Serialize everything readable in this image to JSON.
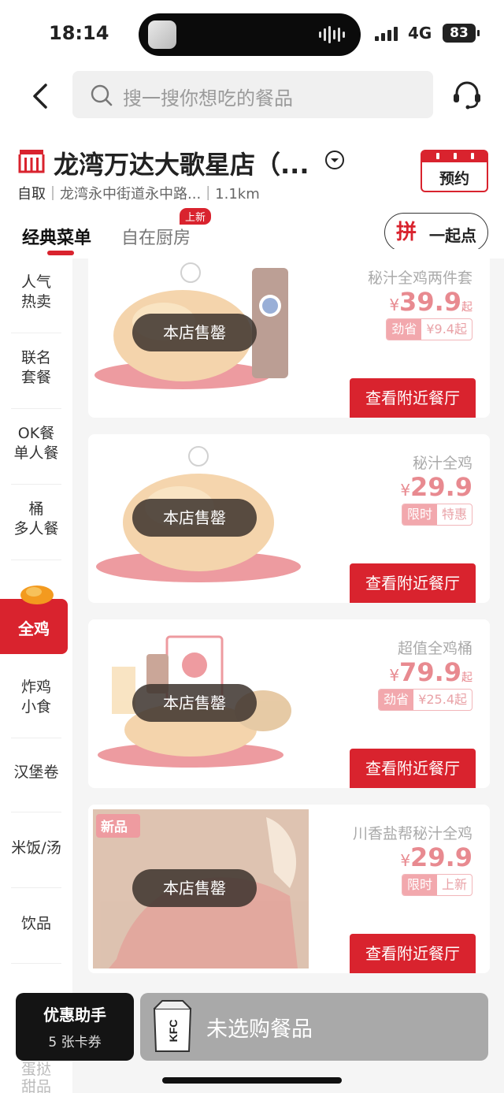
{
  "status_bar": {
    "time": "18:14",
    "network": "4G",
    "battery": "83"
  },
  "search": {
    "placeholder": "搜一搜你想吃的餐品"
  },
  "store": {
    "name": "龙湾万达大歌星店（...",
    "pickup": "自取",
    "address": "｜龙湾永中街道永中路...｜1.1km",
    "reserve_label": "预约"
  },
  "tabs": {
    "classic": "经典菜单",
    "kitchen": "自在厨房",
    "new_badge": "上新"
  },
  "group_order": {
    "icon": "拼",
    "label": "一起点"
  },
  "sidebar": {
    "categories": [
      {
        "line1": "人气",
        "line2": "热卖"
      },
      {
        "line1": "联名",
        "line2": "套餐"
      },
      {
        "line1": "OK餐",
        "line2": "单人餐"
      },
      {
        "line1": "桶",
        "line2": "多人餐"
      },
      {
        "line1": "全鸡",
        "line2": ""
      },
      {
        "line1": "炸鸡",
        "line2": "小食"
      },
      {
        "line1": "汉堡卷",
        "line2": ""
      },
      {
        "line1": "米饭/汤",
        "line2": ""
      },
      {
        "line1": "饮品",
        "line2": ""
      }
    ],
    "peek": [
      "蛋挞",
      "甜品"
    ]
  },
  "products": [
    {
      "name": "秘汁全鸡两件套",
      "currency": "¥",
      "price": "39.9",
      "suffix": "起",
      "tag_a": "劲省",
      "tag_b": "¥9.4起",
      "soldout": "本店售罄",
      "cta": "查看附近餐厅",
      "image_badge": ""
    },
    {
      "name": "秘汁全鸡",
      "currency": "¥",
      "price": "29.9",
      "suffix": "",
      "tag_a": "限时",
      "tag_b": "特惠",
      "soldout": "本店售罄",
      "cta": "查看附近餐厅",
      "image_badge": ""
    },
    {
      "name": "超值全鸡桶",
      "currency": "¥",
      "price": "79.9",
      "suffix": "起",
      "tag_a": "劲省",
      "tag_b": "¥25.4起",
      "soldout": "本店售罄",
      "cta": "查看附近餐厅",
      "image_badge": ""
    },
    {
      "name": "川香盐帮秘汁全鸡",
      "currency": "¥",
      "price": "29.9",
      "suffix": "",
      "tag_a": "限时",
      "tag_b": "上新",
      "soldout": "本店售罄",
      "cta": "查看附近餐厅",
      "image_badge": "新品"
    }
  ],
  "promo": {
    "title": "优惠助手",
    "subtitle": "5 张卡券"
  },
  "cart": {
    "label": "未选购餐品",
    "bag_text": "KFC"
  },
  "colors": {
    "accent": "#d9232e",
    "price_faded": "#e88a90",
    "cart_bar": "#a9a9a9"
  },
  "icons": [
    "back-arrow-icon",
    "search-icon",
    "customer-service-icon",
    "store-icon",
    "dropdown-circle-icon",
    "calendar-icon",
    "kfc-bag-icon"
  ]
}
